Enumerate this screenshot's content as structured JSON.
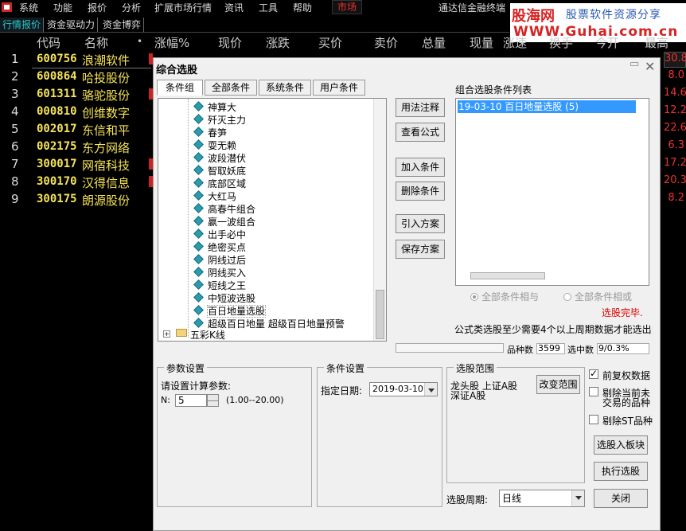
{
  "menubar": {
    "items": [
      "系统",
      "功能",
      "报价",
      "分析",
      "扩展市场行情",
      "资讯",
      "工具",
      "帮助"
    ],
    "market": "市场",
    "app_title": "通达信金融终端"
  },
  "banner": {
    "logo_text": "股海网",
    "slogan": "股票软件资源分享",
    "url": "WWW.Guhai.com.cn"
  },
  "tabs": [
    {
      "label": "行情报价",
      "active": true
    },
    {
      "label": "资金驱动力",
      "active": false
    },
    {
      "label": "资金博弈",
      "active": false
    }
  ],
  "table": {
    "headers": [
      "代码",
      "名称",
      "•",
      "涨幅%",
      "现价",
      "涨跌",
      "买价",
      "卖价",
      "总量",
      "现量",
      "涨速",
      "换手",
      "今开",
      "最高"
    ],
    "rows": [
      {
        "no": "1",
        "code": "600756",
        "name": "浪潮软件",
        "tail": "30.8"
      },
      {
        "no": "2",
        "code": "600864",
        "name": "哈投股份",
        "tail": "8.0"
      },
      {
        "no": "3",
        "code": "601311",
        "name": "骆驼股份",
        "tail": "14.6"
      },
      {
        "no": "4",
        "code": "000810",
        "name": "创维数字",
        "tail": "12.2"
      },
      {
        "no": "5",
        "code": "002017",
        "name": "东信和平",
        "tail": "22.6"
      },
      {
        "no": "6",
        "code": "002175",
        "name": "东方网络",
        "tail": "6.3"
      },
      {
        "no": "7",
        "code": "300017",
        "name": "网宿科技",
        "tail": "17.2"
      },
      {
        "no": "8",
        "code": "300170",
        "name": "汉得信息",
        "tail": "20.3"
      },
      {
        "no": "9",
        "code": "300175",
        "name": "朗源股份",
        "tail": "8.2"
      }
    ]
  },
  "dialog": {
    "title": "综合选股",
    "subtabs": [
      "条件组",
      "全部条件",
      "系统条件",
      "用户条件"
    ],
    "tree_items": [
      "神算大",
      "歼灭主力",
      "春笋",
      "耍无赖",
      "波段潜伏",
      "智取妖底",
      "底部区域",
      "大红马",
      "高春牛组合",
      "赢一波组合",
      "出手必中",
      "绝密买点",
      "阴线过后",
      "阴线买入",
      "短线之王",
      "中短波选股",
      "百日地量选股",
      "超级百日地量   超级百日地量预警"
    ],
    "tree_folder": "五彩K线",
    "buttons": {
      "usage": "用法注释",
      "formula": "查看公式",
      "add": "加入条件",
      "delete": "删除条件",
      "import": "引入方案",
      "save": "保存方案",
      "change_range": "改变范围",
      "to_block": "选股入板块",
      "execute": "执行选股",
      "close": "关闭"
    },
    "list_title": "组合选股条件列表",
    "list_items": [
      "19-03-10  百日地量选股 (5)"
    ],
    "radio_and": "全部条件相与",
    "radio_or": "全部条件相或",
    "status": "选股完毕.",
    "note": "公式类选股至少需要4个以上周期数据才能选出",
    "count_label": "品种数",
    "count_value": "3599",
    "selected_label": "选中数",
    "selected_value": "9/0.3%",
    "param_group": "参数设置",
    "param_prompt": "请设置计算参数:",
    "param_name": "N:",
    "param_value": "5",
    "param_range": "(1.00--20.00)",
    "cond_group": "条件设置",
    "date_label": "指定日期:",
    "date_value": "2019-03-10",
    "range_group": "选股范围",
    "range_text_1": "龙头股  上证A股",
    "range_text_2": "深证A股",
    "check_fq": "前复权数据",
    "check_fq_on": true,
    "check_exclude_1": "剔除当前未",
    "check_exclude_2": "交易的品种",
    "check_st": "剔除ST品种",
    "period_label": "选股周期:",
    "period_value": "日线",
    "colors": {
      "selection": "#3399ff",
      "status_red": "#e00000"
    }
  }
}
